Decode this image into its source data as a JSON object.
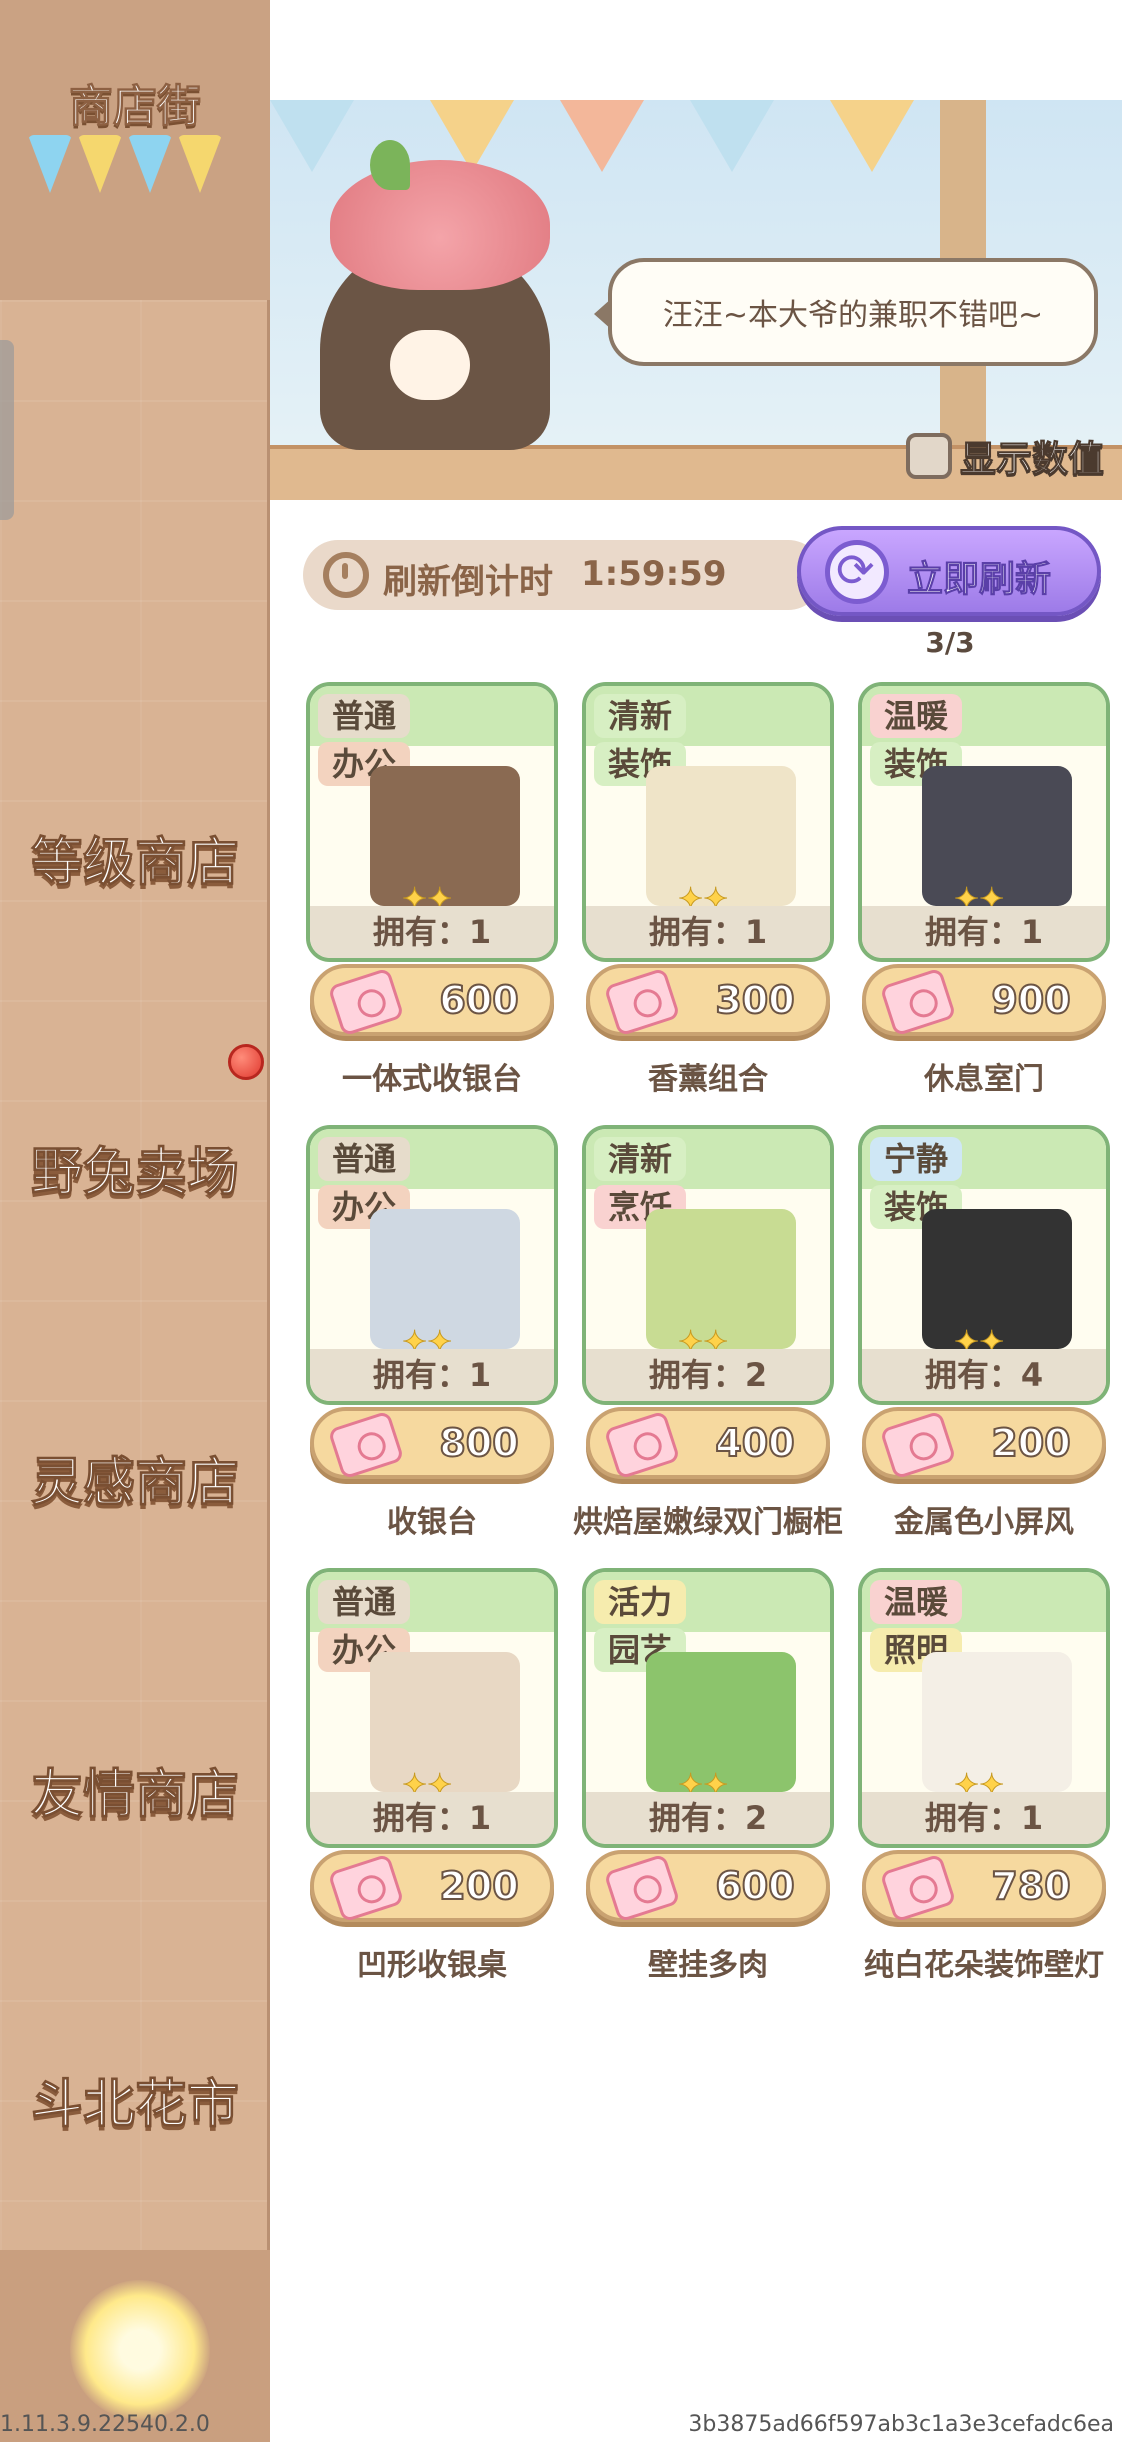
{
  "sidebar": {
    "title": "商店街",
    "tabs": [
      {
        "label": "等级商店"
      },
      {
        "label": "野兔卖场"
      },
      {
        "label": "灵感商店"
      },
      {
        "label": "友情商店"
      },
      {
        "label": "斗北花市"
      }
    ],
    "flag_colors": [
      "#8ed4f0",
      "#f5d76e",
      "#8ed4f0",
      "#f5d76e"
    ]
  },
  "banner": {
    "speech": "汪汪~本大爷的兼职不错吧~",
    "show_values_label": "显示数值",
    "show_values_checked": false
  },
  "refresh": {
    "label": "刷新倒计时",
    "countdown": "1:59:59",
    "button_label": "立即刷新",
    "count": "3/3"
  },
  "items": [
    {
      "tag1": "普通",
      "tag2": "办公",
      "owned": "拥有：1",
      "price": "600",
      "name": "一体式收银台"
    },
    {
      "tag1": "清新",
      "tag2": "装饰",
      "owned": "拥有：1",
      "price": "300",
      "name": "香薰组合"
    },
    {
      "tag1": "温暖",
      "tag2": "装饰",
      "owned": "拥有：1",
      "price": "900",
      "name": "休息室门"
    },
    {
      "tag1": "普通",
      "tag2": "办公",
      "owned": "拥有：1",
      "price": "800",
      "name": "收银台"
    },
    {
      "tag1": "清新",
      "tag2": "烹饪",
      "owned": "拥有：2",
      "price": "400",
      "name": "烘焙屋嫩绿双门橱柜"
    },
    {
      "tag1": "宁静",
      "tag2": "装饰",
      "owned": "拥有：4",
      "price": "200",
      "name": "金属色小屏风"
    },
    {
      "tag1": "普通",
      "tag2": "办公",
      "owned": "拥有：1",
      "price": "200",
      "name": "凹形收银桌"
    },
    {
      "tag1": "活力",
      "tag2": "园艺",
      "owned": "拥有：2",
      "price": "600",
      "name": "壁挂多肉"
    },
    {
      "tag1": "温暖",
      "tag2": "照明",
      "owned": "拥有：1",
      "price": "780",
      "name": "纯白花朵装饰壁灯"
    }
  ],
  "tag_colors": {
    "普通": "#e6dccb",
    "清新": "#d7efc3",
    "温暖": "#f9d2d0",
    "宁静": "#cfe7f5",
    "活力": "#f6ecae",
    "办公": "#f3d3bf",
    "装饰": "#d7efc3",
    "烹饪": "#f9d2d0",
    "园艺": "#d7efc3",
    "照明": "#f6ecae"
  },
  "stars": "✦✦",
  "footer": {
    "version": "1.11.3.9.22540.2.0",
    "hash": "3b3875ad66f597ab3c1a3e3cefadc6ea"
  }
}
